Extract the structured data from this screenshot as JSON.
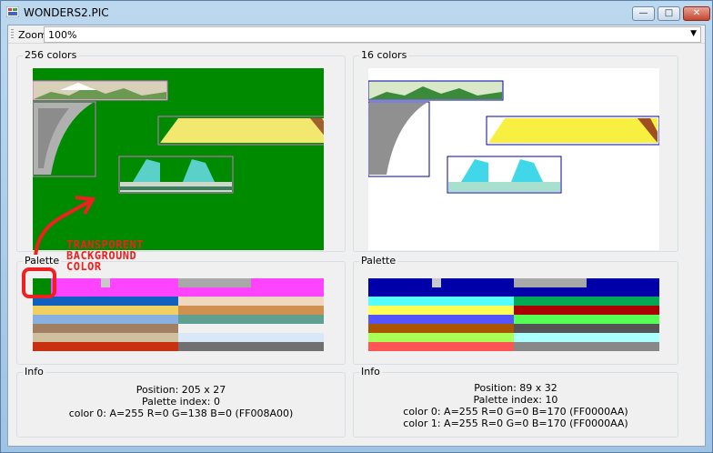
{
  "window": {
    "title": "WONDERS2.PIC",
    "minimize_glyph": "—",
    "maximize_glyph": "□",
    "close_glyph": "✕"
  },
  "toolbar": {
    "zoom_label": "Zoom",
    "zoom_value": "100%",
    "zoom_arrow": "▼"
  },
  "left": {
    "image_group_label": "256 colors",
    "palette_group_label": "Palette",
    "info_group_label": "Info",
    "info_lines": [
      "Position: 205 x 27",
      "Palette index: 0",
      "color 0: A=255 R=0 G=138 B=0 (FF008A00)"
    ],
    "annotation_lines": [
      "TRANSPORENT",
      "BACKGROUND",
      "COLOR"
    ]
  },
  "right": {
    "image_group_label": "16 colors",
    "palette_group_label": "Palette",
    "info_group_label": "Info",
    "info_lines": [
      "Position: 89 x 32",
      "Palette index: 10",
      "color 0: A=255 R=0 G=0 B=170 (FF0000AA)",
      "color 1: A=255 R=0 G=0 B=170 (FF0000AA)"
    ]
  },
  "colors": {
    "transparent_background": "#008A00",
    "highlight_border": "#d070d0",
    "annotation": "#ee2020",
    "dark_blue": "#0000AA",
    "magenta": "#ff44ff"
  }
}
